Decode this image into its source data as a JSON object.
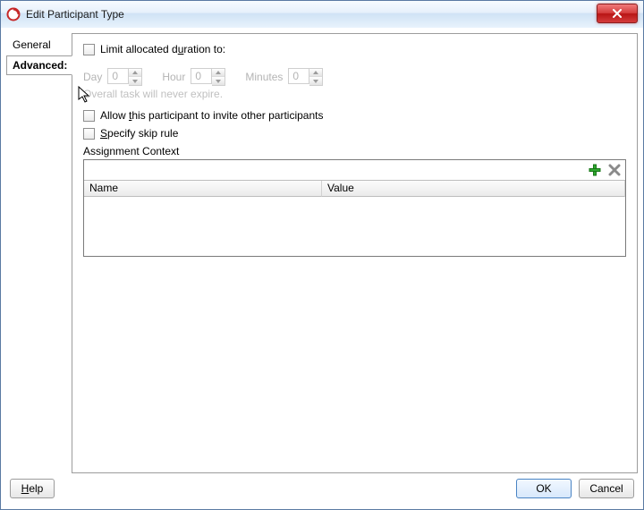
{
  "window": {
    "title": "Edit Participant Type"
  },
  "tabs": {
    "general": "General",
    "advanced": "Advanced:"
  },
  "panel": {
    "limit_label_pre": "Limit allocated d",
    "limit_label_u": "u",
    "limit_label_post": "ration to:",
    "day": {
      "label": "Day",
      "value": "0"
    },
    "hour": {
      "label": "Hour",
      "value": "0"
    },
    "minutes": {
      "label": "Minutes",
      "value": "0"
    },
    "expire_hint": "Overall task will never expire.",
    "allow_invite_pre": "Allow ",
    "allow_invite_u": "t",
    "allow_invite_post": "his participant to invite other participants",
    "skip_pre": "",
    "skip_u": "S",
    "skip_post": "pecify skip rule",
    "context_label": "Assignment Context",
    "col_name": "Name",
    "col_value": "Value"
  },
  "footer": {
    "help_u": "H",
    "help_post": "elp",
    "ok": "OK",
    "cancel": "Cancel"
  }
}
